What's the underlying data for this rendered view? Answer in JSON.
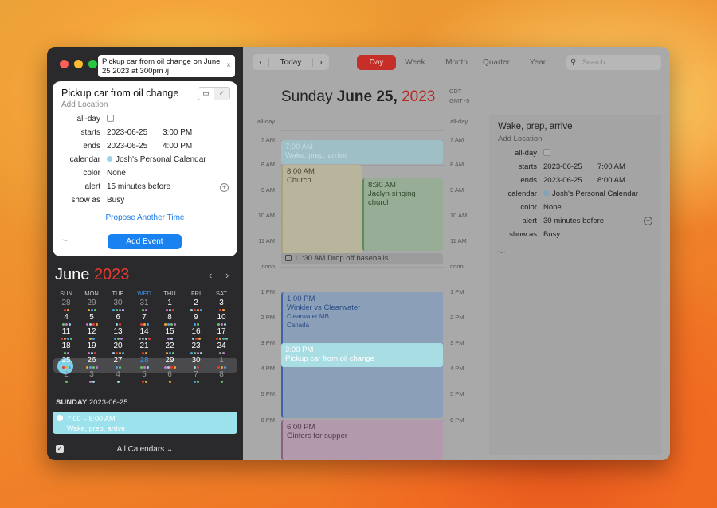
{
  "quick_entry": {
    "value": "Pickup car from oil change on June 25 2023 at 300pm /j",
    "clear": "×"
  },
  "new_event": {
    "title": "Pickup car from oil change",
    "location_placeholder": "Add Location",
    "labels": {
      "all_day": "all-day",
      "starts": "starts",
      "ends": "ends",
      "calendar": "calendar",
      "color": "color",
      "alert": "alert",
      "show_as": "show as"
    },
    "starts_date": "2023-06-25",
    "starts_time": "3:00 PM",
    "ends_date": "2023-06-25",
    "ends_time": "4:00 PM",
    "calendar": "Josh's Personal Calendar",
    "calendar_color": "#9fd3e4",
    "color": "None",
    "alert": "15 minutes before",
    "show_as": "Busy",
    "propose": "Propose Another Time",
    "add_button": "Add Event"
  },
  "mini_calendar": {
    "month": "June",
    "year": "2023",
    "weekdays": [
      "SUN",
      "MON",
      "TUE",
      "WED",
      "THU",
      "FRI",
      "SAT"
    ],
    "weeks": [
      [
        "28",
        "29",
        "30",
        "31",
        "1",
        "2",
        "3"
      ],
      [
        "4",
        "5",
        "6",
        "7",
        "8",
        "9",
        "10"
      ],
      [
        "11",
        "12",
        "13",
        "14",
        "15",
        "16",
        "17"
      ],
      [
        "18",
        "19",
        "20",
        "21",
        "22",
        "23",
        "24"
      ],
      [
        "25",
        "26",
        "27",
        "28",
        "29",
        "30",
        "1"
      ],
      [
        "2",
        "3",
        "4",
        "5",
        "6",
        "7",
        "8"
      ]
    ],
    "selected_date": "25"
  },
  "agenda": {
    "day": "SUNDAY",
    "date": "2023-06-25",
    "event_time": "7:00 – 8:00 AM",
    "event_title": "Wake, prep, arrive"
  },
  "footer": {
    "calendars": "All Calendars"
  },
  "toolbar": {
    "today": "Today",
    "views": [
      "Day",
      "Week",
      "Month",
      "Quarter",
      "Year"
    ],
    "active_view": "Day",
    "search_placeholder": "Search"
  },
  "day_header": {
    "weekday": "Sunday",
    "date": "June 25,",
    "year": "2023",
    "tz1": "CDT",
    "tz2": "GMT -5"
  },
  "time_labels": [
    "all-day",
    "7 AM",
    "8 AM",
    "9 AM",
    "10 AM",
    "11 AM",
    "noon",
    "1 PM",
    "2 PM",
    "3 PM",
    "4 PM",
    "5 PM",
    "6 PM"
  ],
  "events": {
    "wake": {
      "time": "7:00 AM",
      "title": "Wake, prep, arrive"
    },
    "church": {
      "time": "8:00 AM",
      "title": "Church"
    },
    "jaclyn": {
      "time": "8:30 AM",
      "title": "Jaclyn singing church"
    },
    "baseballs": {
      "text": "11:30 AM Drop off baseballs"
    },
    "winkler": {
      "time": "1:00 PM",
      "title": "Winkler vs Clearwater",
      "loc1": "Clearwater MB",
      "loc2": "Canada"
    },
    "pickup": {
      "time": "3:00 PM",
      "title": "Pickup car from oil change"
    },
    "ginters": {
      "time": "6:00 PM",
      "title": "Ginters for supper"
    }
  },
  "detail": {
    "title": "Wake, prep, arrive",
    "location_placeholder": "Add Location",
    "starts_date": "2023-06-25",
    "starts_time": "7:00 AM",
    "ends_date": "2023-06-25",
    "ends_time": "8:00 AM",
    "calendar": "Josh's Personal Calendar",
    "color": "None",
    "alert": "30 minutes before",
    "show_as": "Busy"
  }
}
